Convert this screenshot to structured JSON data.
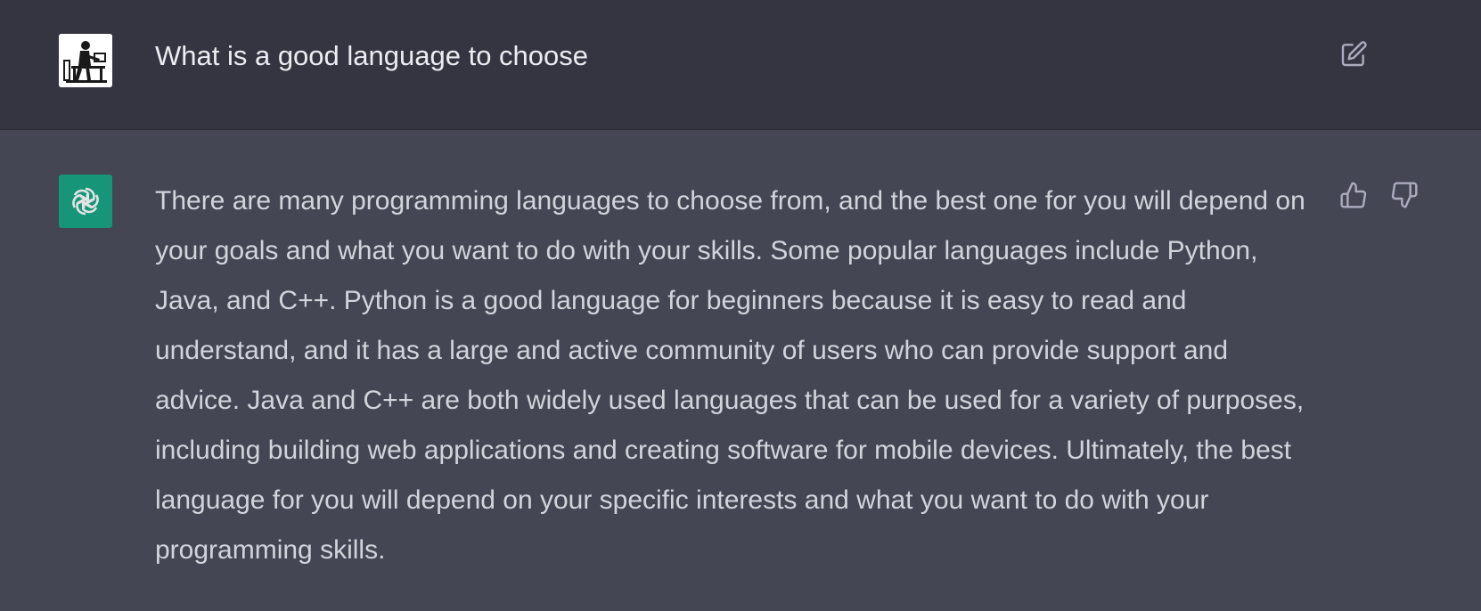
{
  "conversation": {
    "user_message": {
      "text": "What is a good language to choose",
      "avatar_icon": "user-avatar-illustration",
      "edit_icon": "edit-icon"
    },
    "assistant_message": {
      "text": "There are many programming languages to choose from, and the best one for you will depend on your goals and what you want to do with your skills. Some popular languages include Python, Java, and C++. Python is a good language for beginners because it is easy to read and understand, and it has a large and active community of users who can provide support and advice. Java and C++ are both widely used languages that can be used for a variety of purposes, including building web applications and creating software for mobile devices. Ultimately, the best language for you will depend on your specific interests and what you want to do with your programming skills.",
      "avatar_icon": "openai-logo-icon",
      "feedback": {
        "thumbs_up_icon": "thumbs-up-icon",
        "thumbs_down_icon": "thumbs-down-icon"
      }
    }
  },
  "colors": {
    "user_row_bg": "#343541",
    "assistant_row_bg": "#444654",
    "user_text": "#ececf1",
    "assistant_text": "#d1d5db",
    "brand_green": "#10a37f",
    "icon_gray": "#acacbe"
  }
}
